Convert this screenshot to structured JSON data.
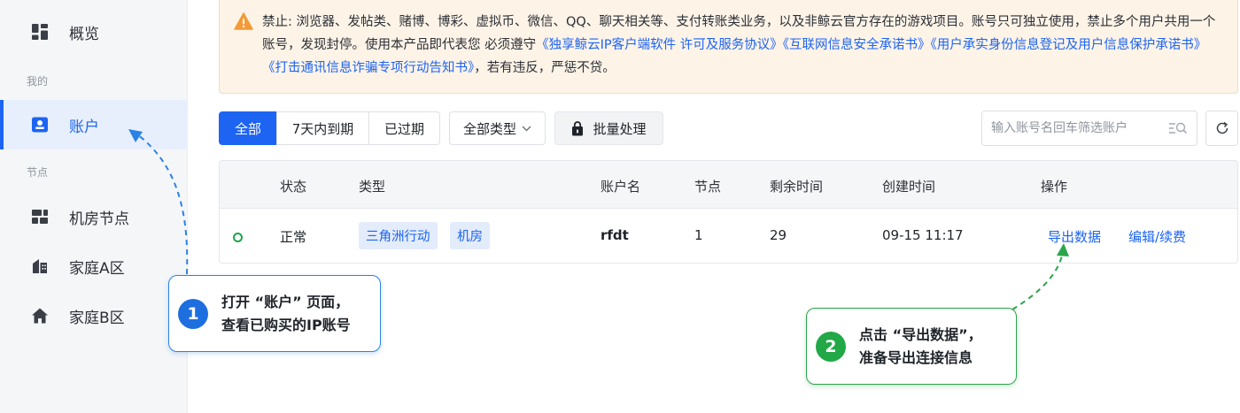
{
  "sidebar": {
    "overview": "概览",
    "section_mine": "我的",
    "account": "账户",
    "section_nodes": "节点",
    "datacenter_node": "机房节点",
    "home_a": "家庭A区",
    "home_b": "家庭B区"
  },
  "notice": {
    "text_1": "禁止: 浏览器、发帖类、赌博、博彩、虚拟币、微信、QQ、聊天相关等、支付转账类业务，以及非鲸云官方存在的游戏项目。账号只可独立使用，禁止多个用户共用一个账号，发现封停。使用本产品即代表您 必须遵守",
    "link_1": "《独享鲸云IP客户端软件 许可及服务协议》",
    "link_2": "《互联网信息安全承诺书》",
    "link_3": "《用户承实身份信息登记及用户信息保护承诺书》",
    "link_4": "《打击通讯信息诈骗专项行动告知书》",
    "text_2": "，若有违反，严惩不贷。"
  },
  "toolbar": {
    "filter_all": "全部",
    "filter_expiring": "7天内到期",
    "filter_expired": "已过期",
    "type_select": "全部类型",
    "batch": "批量处理",
    "search_placeholder": "输入账号名回车筛选账户"
  },
  "table": {
    "headers": {
      "status": "状态",
      "type": "类型",
      "account": "账户名",
      "nodes": "节点",
      "remaining": "剩余时间",
      "created": "创建时间",
      "actions": "操作"
    },
    "rows": [
      {
        "status": "正常",
        "tags": [
          "三角洲行动",
          "机房"
        ],
        "account": "rfdt",
        "nodes": "1",
        "remaining": "29",
        "created": "09-15 11:17",
        "action_export": "导出数据",
        "action_edit": "编辑/续费"
      }
    ]
  },
  "callouts": {
    "step1": {
      "num": "1",
      "line1": "打开 “账户” 页面，",
      "line2": "查看已购买的IP账号"
    },
    "step2": {
      "num": "2",
      "line1": "点击 “导出数据”，",
      "line2": "准备导出连接信息"
    }
  },
  "colors": {
    "accent": "#1d64f2",
    "status_ok": "#20a34b",
    "notice_bg": "#fdf3e7",
    "warning": "#f29a38"
  },
  "icons": [
    "grid-icon",
    "user-card-icon",
    "server-icon",
    "house-icon",
    "warning-icon",
    "lock-icon",
    "chevron-down-icon",
    "search-filter-icon",
    "refresh-icon"
  ]
}
